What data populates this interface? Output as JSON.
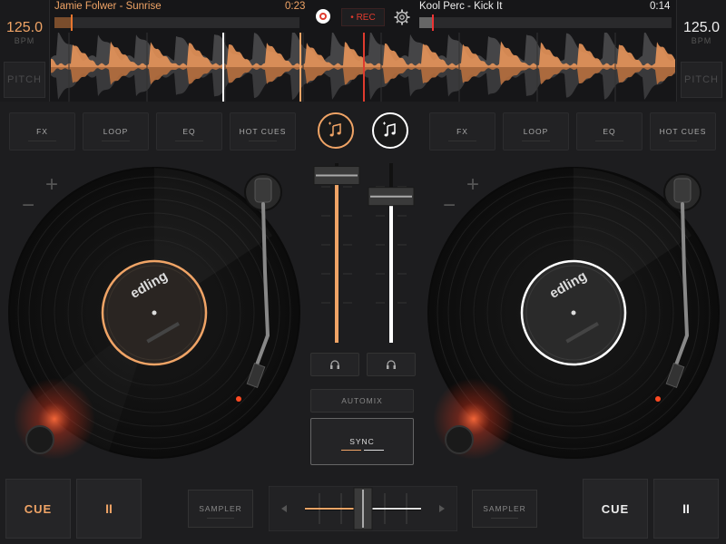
{
  "colors": {
    "deck_a": "#f0a466",
    "deck_b": "#ffffff",
    "rec": "#e03b2e",
    "bg": "#1d1d1f"
  },
  "deck_a": {
    "bpm": "125.0",
    "bpm_unit": "BPM",
    "pitch_label": "PITCH",
    "title": "Jamie Folwer - Sunrise",
    "time": "0:23",
    "progress": 0.02,
    "buttons": [
      "FX",
      "LOOP",
      "EQ",
      "HOT CUES"
    ],
    "cue_label": "CUE",
    "play_icon": "pause-icon",
    "play_symbol": "II",
    "sampler_label": "SAMPLER",
    "label_text": "edling"
  },
  "deck_b": {
    "bpm": "125.0",
    "bpm_unit": "BPM",
    "pitch_label": "PITCH",
    "title": "Kool Perc - Kick It",
    "time": "0:14",
    "progress": 0.04,
    "buttons": [
      "FX",
      "LOOP",
      "EQ",
      "HOT CUES"
    ],
    "cue_label": "CUE",
    "play_icon": "pause-icon",
    "play_symbol": "II",
    "sampler_label": "SAMPLER",
    "label_text": "edling"
  },
  "header": {
    "rec_label": "• REC",
    "logo_icon": "edjing-logo-icon",
    "settings_icon": "gear-icon"
  },
  "mixer": {
    "automix_label": "AUTOMIX",
    "sync_label": "SYNC",
    "volume_a": 0.98,
    "volume_b": 0.85,
    "crossfader": 0.5,
    "headphones_icon": "headphones-icon"
  }
}
